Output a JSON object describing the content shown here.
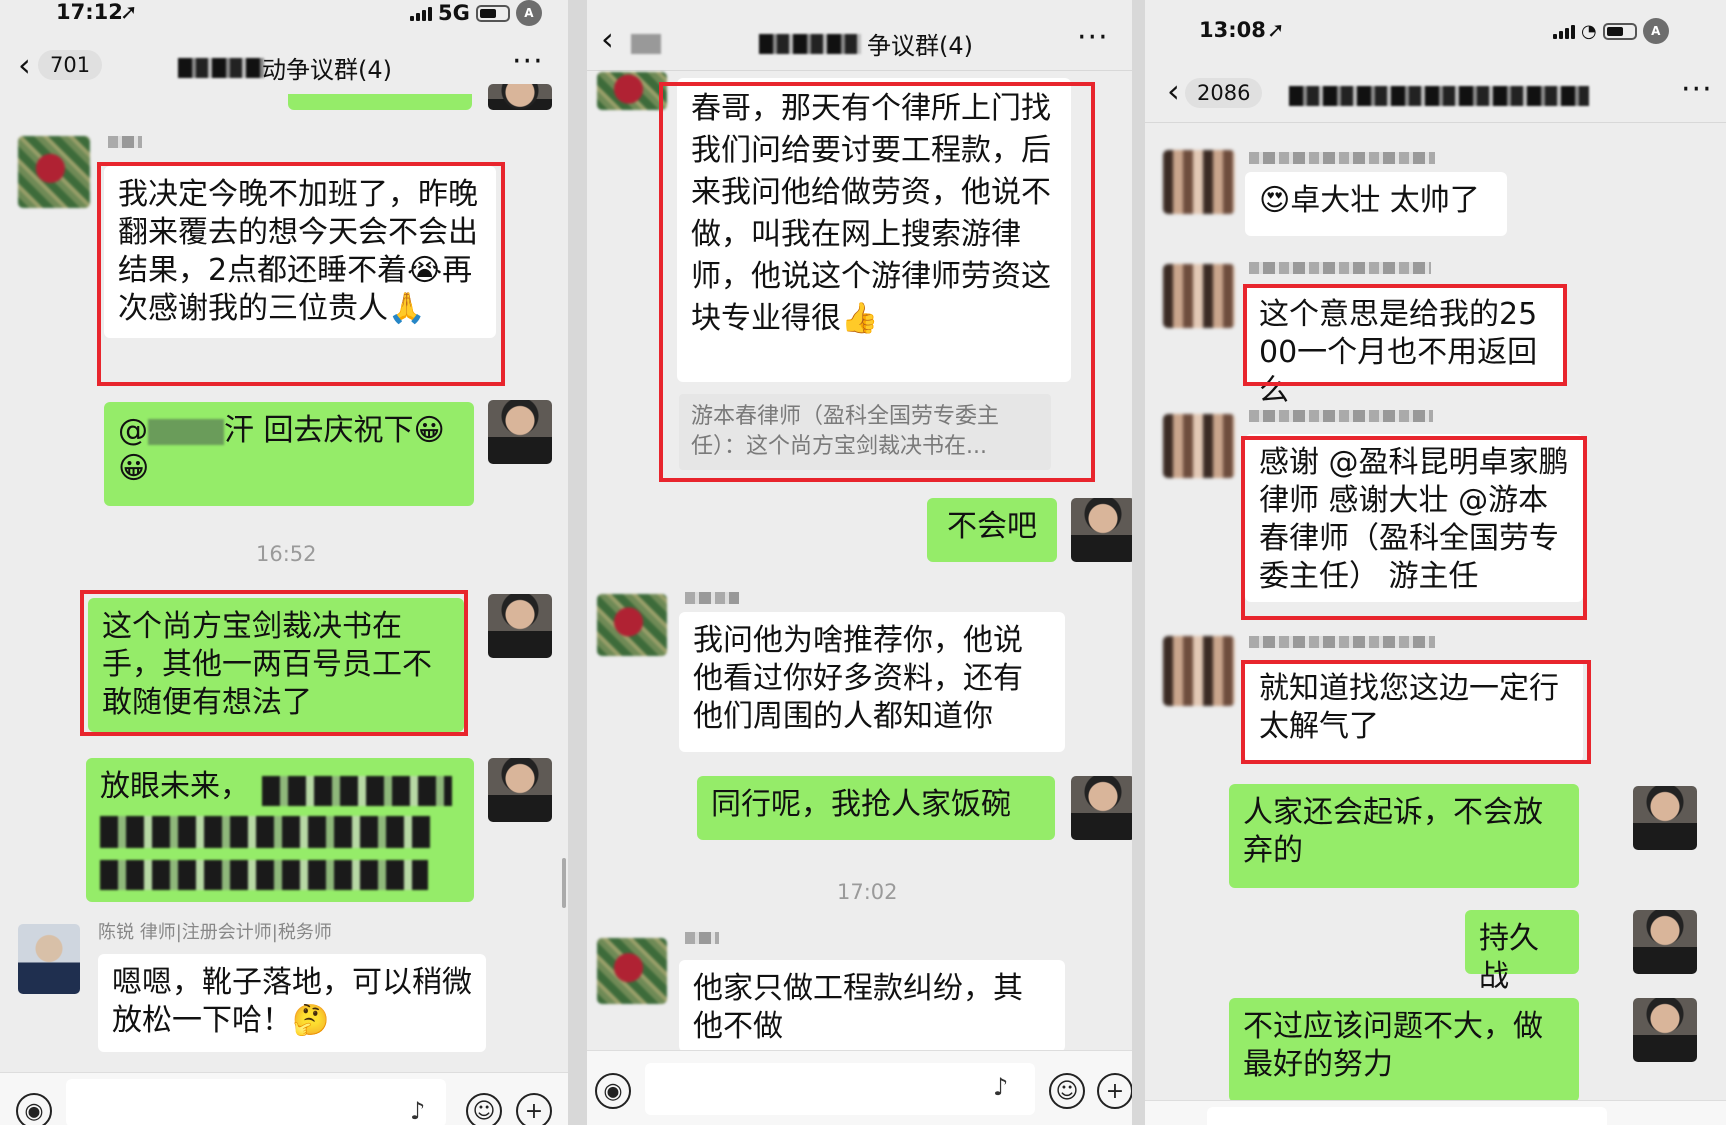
{
  "panel1": {
    "status": {
      "time": "17:12",
      "network": "5G"
    },
    "header": {
      "back_count": "701",
      "title": "动争议群(4)",
      "more": "···"
    },
    "messages": {
      "m1": "我决定今晚不加班了，昨晚翻来覆去的想今天会不会出结果，2点都还睡不着😭再次感谢我的三位贵人🙏",
      "m2_prefix": "@",
      "m2_suffix": "汗 回去庆祝下😀",
      "m2_line2": "😀",
      "timestamp": "16:52",
      "m3": "这个尚方宝剑裁决书在手，其他一两百号员工不敢随便有想法了",
      "m4_prefix": "放眼未来，",
      "sender_chen": "陈锐 律师|注册会计师|税务师",
      "m5": "嗯嗯，靴子落地，可以稍微放松一下哈！🤔"
    }
  },
  "panel2": {
    "header": {
      "title": "争议群(4)",
      "more": "···"
    },
    "messages": {
      "m1": "春哥，那天有个律所上门找我们问给要讨要工程款，后来我问他给做劳资，他说不做，叫我在网上搜索游律师，他说这个游律师劳资这块专业得很👍",
      "quote": "游本春律师（盈科全国劳专委主任）：这个尚方宝剑裁决书在...",
      "m2": "不会吧",
      "m3": "我问他为啥推荐你，他说他看过你好多资料，还有他们周围的人都知道你",
      "m4": "同行呢，我抢人家饭碗",
      "timestamp": "17:02",
      "m5": "他家只做工程款纠纷，其他不做"
    }
  },
  "panel3": {
    "status": {
      "time": "13:08"
    },
    "header": {
      "back_count": "2086",
      "more": "···"
    },
    "messages": {
      "m1": "😍卓大壮 太帅了",
      "m2": "这个意思是给我的2500一个月也不用返回么",
      "m3": "感谢 @盈科昆明卓家鹏律师 感谢大壮 @游本春律师（盈科全国劳专委主任） 游主任",
      "m4": "就知道找您这边一定行 太解气了",
      "m5": "人家还会起诉，不会放弃的",
      "m6": "持久战",
      "m7": "不过应该问题不大，做最好的努力"
    }
  },
  "colors": {
    "chat_bg": "#ededed",
    "green_bubble": "#95ec69",
    "white_bubble": "#ffffff",
    "highlight_red": "#e8252d"
  },
  "icons": [
    "signal-icon",
    "battery-icon",
    "back-chevron-icon",
    "more-icon",
    "voice-icon",
    "mic-icon",
    "emoji-icon",
    "plus-icon"
  ]
}
